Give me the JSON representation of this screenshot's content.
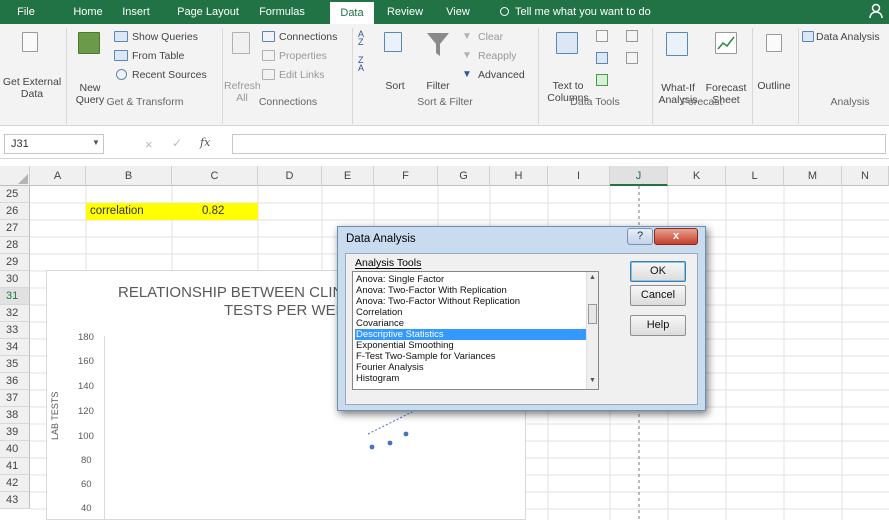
{
  "tabs": [
    "File",
    "Home",
    "Insert",
    "Page Layout",
    "Formulas",
    "Data",
    "Review",
    "View"
  ],
  "active_tab": "Data",
  "tell_me": "Tell me what you want to do",
  "ribbon": {
    "get_external_l1": "Get External",
    "get_external_l2": "Data",
    "new_query_l1": "New",
    "new_query_l2": "Query",
    "show_queries": "Show Queries",
    "from_table": "From Table",
    "recent_sources": "Recent Sources",
    "group_get_transform": "Get & Transform",
    "refresh_l1": "Refresh",
    "refresh_l2": "All",
    "connections": "Connections",
    "properties": "Properties",
    "edit_links": "Edit Links",
    "group_connections": "Connections",
    "sort": "Sort",
    "filter": "Filter",
    "clear": "Clear",
    "reapply": "Reapply",
    "advanced": "Advanced",
    "group_sort_filter": "Sort & Filter",
    "text_to_l1": "Text to",
    "text_to_l2": "Columns",
    "group_data_tools": "Data Tools",
    "what_if_l1": "What-If",
    "what_if_l2": "Analysis",
    "forecast_l1": "Forecast",
    "forecast_l2": "Sheet",
    "group_forecast": "Forecast",
    "outline": "Outline",
    "data_analysis": "Data Analysis",
    "group_analysis": "Analysis"
  },
  "name_box": "J31",
  "fx": "fx",
  "columns": [
    "A",
    "B",
    "C",
    "D",
    "E",
    "F",
    "G",
    "H",
    "I",
    "J",
    "K",
    "L",
    "M",
    "N"
  ],
  "rows": [
    "25",
    "26",
    "27",
    "28",
    "29",
    "30",
    "31",
    "32",
    "33",
    "34",
    "35",
    "36",
    "37",
    "38",
    "39",
    "40",
    "41",
    "42",
    "43"
  ],
  "cells": {
    "b26": "correlation",
    "c26": "0.82"
  },
  "chart": {
    "title_l1": "RELATIONSHIP BETWEEN CLINIC",
    "title_l2": "TESTS PER WEEK",
    "ylabel": "LAB TESTS",
    "yticks": [
      "180",
      "160",
      "140",
      "120",
      "100",
      "80",
      "60",
      "40"
    ]
  },
  "dialog": {
    "title": "Data Analysis",
    "help_glyph": "?",
    "close_glyph": "x",
    "list_label": "Analysis Tools",
    "items": [
      "Anova: Single Factor",
      "Anova: Two-Factor With Replication",
      "Anova: Two-Factor Without Replication",
      "Correlation",
      "Covariance",
      "Descriptive Statistics",
      "Exponential Smoothing",
      "F-Test Two-Sample for Variances",
      "Fourier Analysis",
      "Histogram"
    ],
    "selected_index": 5,
    "ok": "OK",
    "cancel": "Cancel",
    "help": "Help"
  },
  "colors": {
    "ribbon_green": "#217346",
    "highlight_yellow": "#ffff00",
    "selection_blue": "#3399ff",
    "chart_dots": "#4472c4"
  }
}
